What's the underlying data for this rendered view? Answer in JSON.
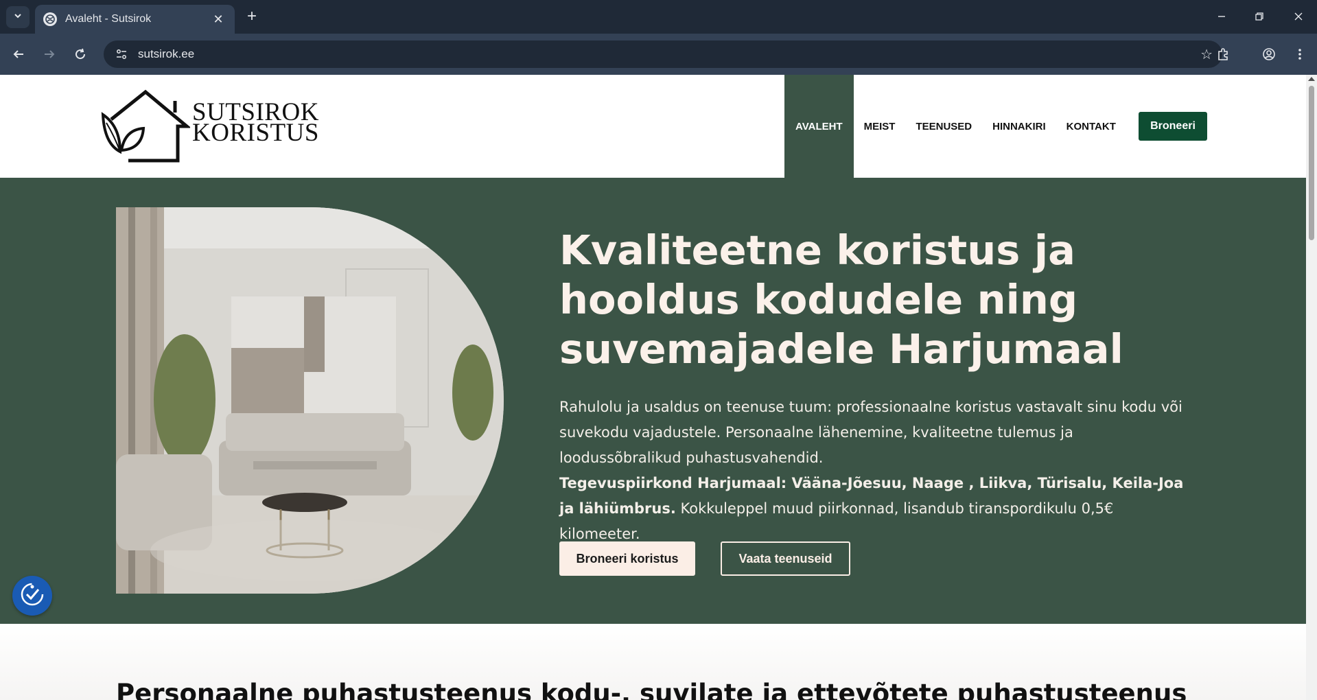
{
  "browser": {
    "tab_title": "Avaleht - Sutsirok",
    "url": "sutsirok.ee"
  },
  "header": {
    "logo_text_line1": "SUTSIROK",
    "logo_text_line2": "KORISTUS",
    "nav": [
      {
        "label": "AVALEHT",
        "active": true
      },
      {
        "label": "MEIST",
        "active": false
      },
      {
        "label": "TEENUSED",
        "active": false
      },
      {
        "label": "HINNAKIRI",
        "active": false
      },
      {
        "label": "KONTAKT",
        "active": false
      }
    ],
    "book_button": "Broneeri"
  },
  "hero": {
    "title": "Kvaliteetne koristus ja hooldus kodudele ning suvemajadele Harjumaal",
    "paragraph": "Rahulolu ja usaldus on teenuse tuum: professionaalne koristus vastavalt sinu kodu või suvekodu vajadustele. Personaalne lähenemine, kvaliteetne tulemus ja loodussõbralikud puhastusvahendid.",
    "area_bold": "Tegevuspiirkond Harjumaal: Vääna-Jõesuu, Naage , Liikva, Türisalu, Keila-Joa ja lähiümbrus.",
    "area_rest": " Kokkuleppel muud piirkonnad, lisandub tiranspordikulu 0,5€ kilomeeter.",
    "primary_button": "Broneeri koristus",
    "secondary_button": "Vaata teenuseid"
  },
  "section2": {
    "title": "Personaalne puhastusteenus kodu-, suvilate ja ettevõtete puhastusteenus"
  },
  "colors": {
    "hero_bg": "#3b5446",
    "accent": "#0e4d32",
    "chrome_dark": "#1f2937"
  }
}
